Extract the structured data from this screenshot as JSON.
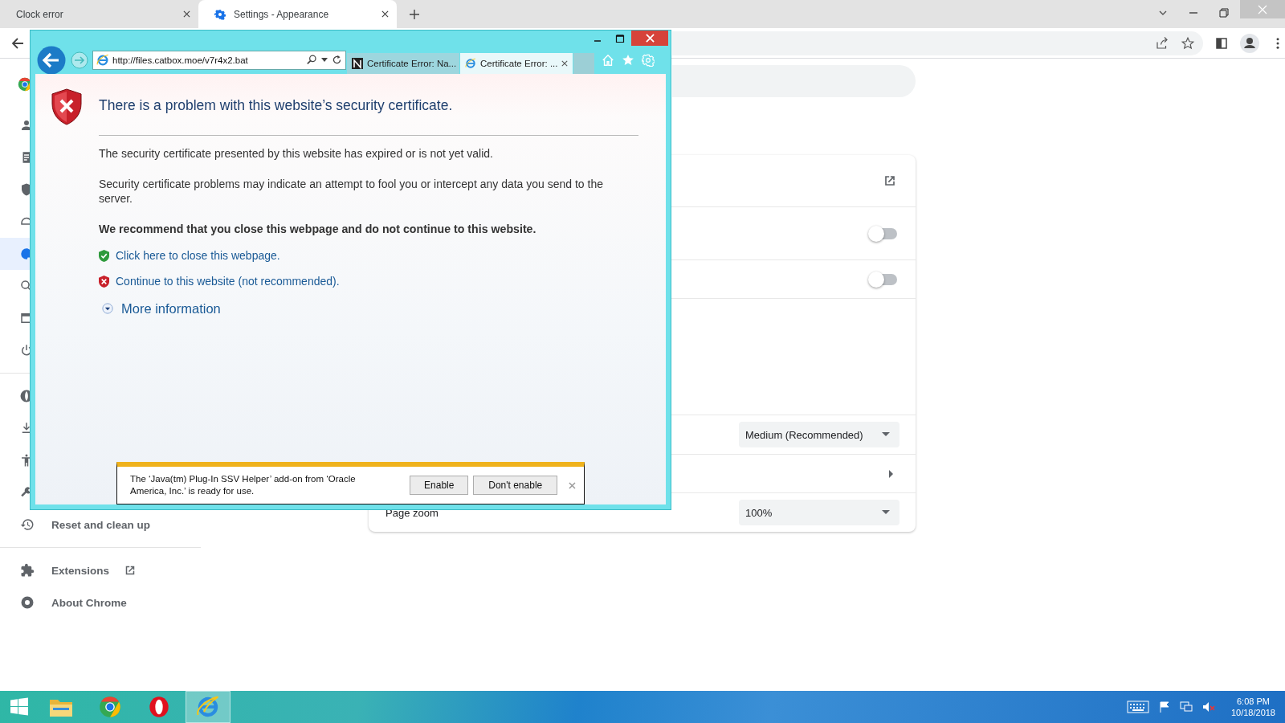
{
  "chrome": {
    "tabs": [
      {
        "title": "Clock error",
        "selected": false
      },
      {
        "title": "Settings - Appearance",
        "selected": true
      }
    ],
    "sidebar": {
      "sections": [
        {
          "covered": [
            {
              "selected": false
            },
            {
              "selected": false
            },
            {
              "selected": false
            },
            {
              "selected": false
            },
            {
              "selected": true
            },
            {
              "selected": false
            },
            {
              "selected": false
            },
            {
              "selected": false
            }
          ]
        },
        {
          "covered": [
            {
              "selected": false
            },
            {
              "selected": false
            },
            {
              "selected": false
            },
            {
              "selected": false
            }
          ],
          "items": [
            {
              "kind": "history",
              "label": "Reset and clean up"
            }
          ]
        },
        {
          "items": [
            {
              "kind": "puzzle",
              "label": "Extensions"
            },
            {
              "kind": "chrome",
              "label": "About Chrome"
            }
          ]
        }
      ]
    },
    "card": {
      "rows": [
        {
          "kind": "link"
        },
        {
          "kind": "toggle",
          "on": false
        },
        {
          "kind": "toggle",
          "on": false
        },
        {
          "kind": "blank"
        },
        {
          "kind": "select",
          "value": "Medium (Recommended)"
        },
        {
          "kind": "submenu"
        },
        {
          "kind": "select",
          "label": "Page zoom",
          "value": "100%"
        }
      ]
    }
  },
  "ie": {
    "address": "http://files.catbox.moe/v7r4x2.bat",
    "tabs": [
      {
        "kind": "favicon",
        "title": "Certificate Error: Na...",
        "selected": false
      },
      {
        "kind": "ie",
        "title": "Certificate Error: ...",
        "selected": true
      }
    ],
    "page": {
      "heading": "There is a problem with this website’s security certificate.",
      "paragraphs": [
        "The security certificate presented by this website has expired or is not yet valid.",
        "Security certificate problems may indicate an attempt to fool you or intercept any data you send to the server."
      ],
      "recommendation": "We recommend that you close this webpage and do not continue to this website.",
      "links": [
        {
          "kind": "safe",
          "text": "Click here to close this webpage."
        },
        {
          "kind": "unsafe",
          "text": "Continue to this website (not recommended)."
        }
      ],
      "more_info": "More information"
    },
    "notification": {
      "message": "The ‘Java(tm) Plug-In SSV Helper’ add-on from ‘Oracle America, Inc.’ is ready for use.",
      "buttons": [
        "Enable",
        "Don't enable"
      ]
    }
  },
  "taskbar": {
    "apps": [
      {
        "kind": "explorer",
        "selected": false
      },
      {
        "kind": "chrome",
        "selected": false
      },
      {
        "kind": "opera",
        "selected": false
      },
      {
        "kind": "ie",
        "selected": true
      }
    ],
    "time": "6:08 PM",
    "date": "10/18/2018"
  }
}
